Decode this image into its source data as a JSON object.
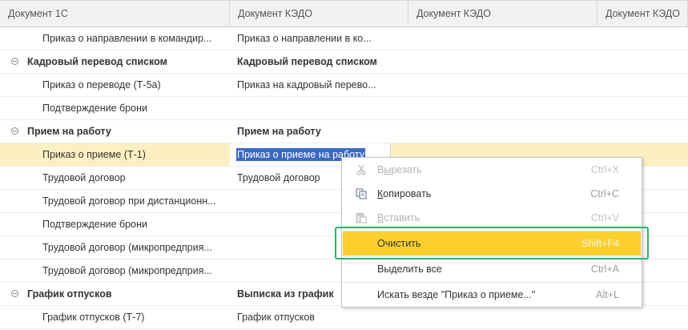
{
  "columns": [
    "Документ 1С",
    "Документ КЭДО",
    "Документ КЭДО",
    "Документ КЭДО"
  ],
  "rows": [
    {
      "kind": "child",
      "c1": "Приказ о направлении в командир...",
      "c2": "Приказ о направлении в ко..."
    },
    {
      "kind": "group",
      "c1": "Кадровый перевод списком",
      "c2": "Кадровый перевод списком"
    },
    {
      "kind": "child",
      "c1": "Приказ о переводе (Т-5а)",
      "c2": "Приказ на кадровый перево..."
    },
    {
      "kind": "child",
      "c1": "Подтверждение брони",
      "c2": ""
    },
    {
      "kind": "group",
      "c1": "Прием на работу",
      "c2": "Прием на работу"
    },
    {
      "kind": "child",
      "c1": "Приказ о приеме (Т-1)",
      "c2": "Приказ о приеме на работу"
    },
    {
      "kind": "child",
      "c1": "Трудовой договор",
      "c2": "Трудовой договор"
    },
    {
      "kind": "child",
      "c1": "Трудовой договор при дистанционн...",
      "c2": ""
    },
    {
      "kind": "child",
      "c1": "Подтверждение брони",
      "c2": ""
    },
    {
      "kind": "child",
      "c1": "Трудовой договор (микропредприя...",
      "c2": ""
    },
    {
      "kind": "child",
      "c1": "Трудовой договор (микропредприя...",
      "c2": ""
    },
    {
      "kind": "group",
      "c1": "График отпусков",
      "c2": "Выписка из график"
    },
    {
      "kind": "child",
      "c1": "График отпусков (Т-7)",
      "c2": "График отпусков"
    }
  ],
  "editor_value": "Приказ о приеме на работу",
  "context_menu": {
    "cut": {
      "label": "Вырезать",
      "accel": "ы",
      "key": "Ctrl+X"
    },
    "copy": {
      "label": "Копировать",
      "accel": "К",
      "key": "Ctrl+C"
    },
    "paste": {
      "label": "Вставить",
      "accel": "В",
      "key": "Ctrl+V"
    },
    "clear": {
      "label": "Очистить",
      "key": "Shift+F4"
    },
    "select_all": {
      "label": "Выделить все",
      "key": "Ctrl+A"
    },
    "search": {
      "label": "Искать везде \"Приказ о приеме...\"",
      "key": "Alt+L"
    }
  },
  "colors": {
    "selected_row": "#fdf0c0",
    "menu_highlight": "#fccf2c",
    "callout": "#2db36a",
    "text_selection": "#3968c5"
  },
  "icons": {
    "cut": "scissors-icon",
    "copy": "copy-icon",
    "paste": "paste-icon",
    "collapse": "collapse-minus-icon"
  }
}
